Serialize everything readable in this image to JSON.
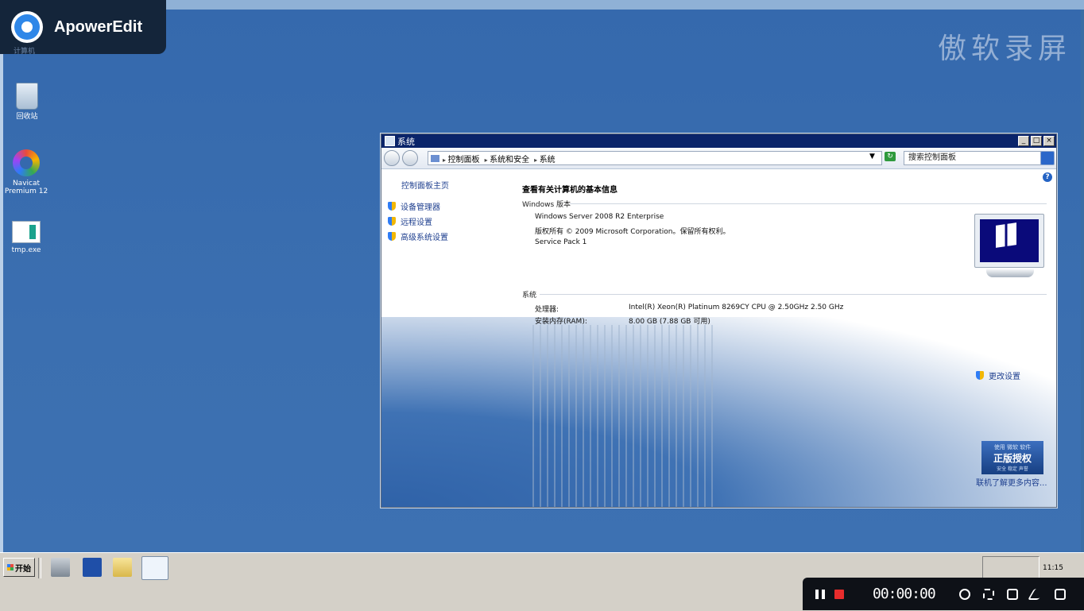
{
  "recorder_app": {
    "name": "ApowerEdit",
    "watermark": "傲软录屏"
  },
  "desktop": {
    "icons": [
      {
        "label": "计算机"
      },
      {
        "label": "回收站"
      },
      {
        "label": "Navicat Premium 12"
      },
      {
        "label": "tmp.exe"
      }
    ]
  },
  "window": {
    "title": "系统",
    "breadcrumb": [
      "控制面板",
      "系统和安全",
      "系统"
    ],
    "search_placeholder": "搜索控制面板",
    "left_panel": {
      "home": "控制面板主页",
      "links": [
        "设备管理器",
        "远程设置",
        "高级系统设置"
      ]
    },
    "main": {
      "heading": "查看有关计算机的基本信息",
      "windows_edition": {
        "section": "Windows 版本",
        "edition": "Windows Server 2008 R2 Enterprise",
        "copyright": "版权所有 © 2009 Microsoft Corporation。保留所有权利。",
        "service_pack": "Service Pack 1"
      },
      "system": {
        "section": "系统",
        "processor_label": "处理器:",
        "processor_value": "Intel(R) Xeon(R) Platinum 8269CY CPU @ 2.50GHz   2.50 GHz",
        "ram_label": "安装内存(RAM):",
        "ram_value": "8.00 GB (7.88 GB 可用)"
      },
      "change_settings": "更改设置",
      "genuine": {
        "line1": "使用 微软 软件",
        "line2": "正版授权",
        "line3": "安全 稳定 声誉"
      },
      "learn_more": "联机了解更多内容..."
    }
  },
  "taskbar": {
    "start_label": "开始",
    "clock_time": "11:15"
  },
  "recorder": {
    "time": "00:00:00"
  },
  "colors": {
    "desktop": "#3a6ea5",
    "titlebar": "#0a246a",
    "link": "#1e3f8f",
    "record": "#e82c2c"
  }
}
